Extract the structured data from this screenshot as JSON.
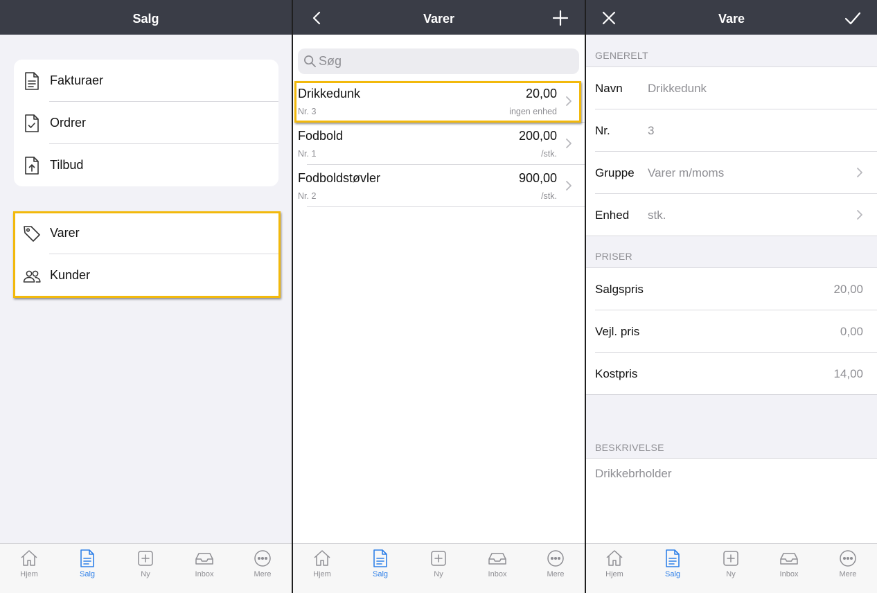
{
  "screen1": {
    "title": "Salg",
    "menu_primary": [
      {
        "label": "Fakturaer",
        "icon": "document-icon"
      },
      {
        "label": "Ordrer",
        "icon": "document-check-icon"
      },
      {
        "label": "Tilbud",
        "icon": "document-upload-icon"
      }
    ],
    "menu_secondary": [
      {
        "label": "Varer",
        "icon": "tag-icon"
      },
      {
        "label": "Kunder",
        "icon": "people-icon"
      }
    ]
  },
  "screen2": {
    "title": "Varer",
    "search_placeholder": "Søg",
    "items": [
      {
        "name": "Drikkedunk",
        "price": "20,00",
        "nr": "Nr. 3",
        "unit": "ingen enhed"
      },
      {
        "name": "Fodbold",
        "price": "200,00",
        "nr": "Nr. 1",
        "unit": "/stk."
      },
      {
        "name": "Fodboldstøvler",
        "price": "900,00",
        "nr": "Nr. 2",
        "unit": "/stk."
      }
    ]
  },
  "screen3": {
    "title": "Vare",
    "sections": {
      "general": "GENERELT",
      "prices": "PRISER",
      "description": "BESKRIVELSE"
    },
    "general_fields": [
      {
        "label": "Navn",
        "value": "Drikkedunk"
      },
      {
        "label": "Nr.",
        "value": "3"
      },
      {
        "label": "Gruppe",
        "value": "Varer m/moms"
      },
      {
        "label": "Enhed",
        "value": "stk."
      }
    ],
    "price_fields": [
      {
        "label": "Salgspris",
        "value": "20,00"
      },
      {
        "label": "Vejl. pris",
        "value": "0,00"
      },
      {
        "label": "Kostpris",
        "value": "14,00"
      }
    ],
    "description_text": "Drikkebrholder"
  },
  "tabbar": [
    {
      "label": "Hjem",
      "icon": "home-icon"
    },
    {
      "label": "Salg",
      "icon": "sales-document-icon",
      "active": true
    },
    {
      "label": "Ny",
      "icon": "plus-square-icon"
    },
    {
      "label": "Inbox",
      "icon": "inbox-tray-icon"
    },
    {
      "label": "Mere",
      "icon": "more-circle-icon"
    }
  ],
  "colors": {
    "nav_bar": "#3a3d47",
    "highlight": "#f2b90c",
    "accent": "#2f80e8",
    "background": "#f2f2f7"
  }
}
